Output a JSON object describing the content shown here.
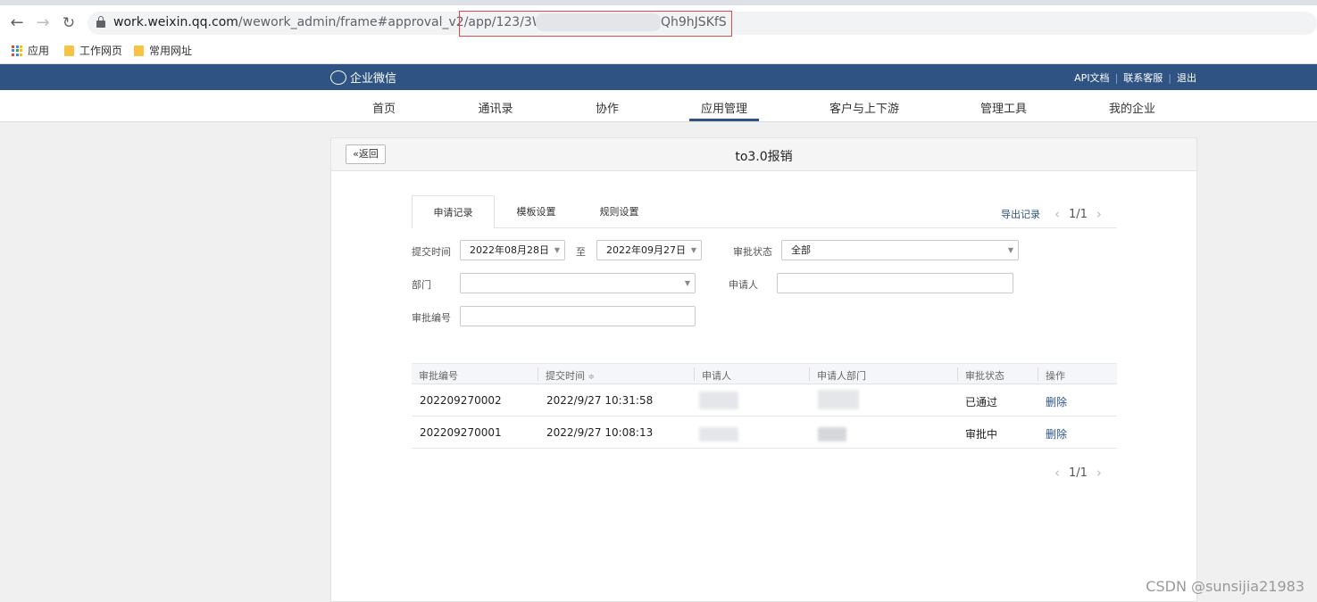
{
  "browser": {
    "url_host": "work.weixin.qq.com",
    "url_path": "/wework_admin/frame#approval_v2/app/123/3WKi3uFpijc",
    "url_tail": "Qh9hJSKfS",
    "bookmarks": [
      "应用",
      "工作网页",
      "常用网址"
    ]
  },
  "header": {
    "logo_text": "企业微信",
    "links": [
      "API文档",
      "联系客服",
      "退出"
    ]
  },
  "nav": {
    "items": [
      "首页",
      "通讯录",
      "协作",
      "应用管理",
      "客户与上下游",
      "管理工具",
      "我的企业"
    ],
    "active": "应用管理"
  },
  "card": {
    "back_label": "返回",
    "title": "to3.0报销"
  },
  "tabs": {
    "items": [
      "申请记录",
      "模板设置",
      "规则设置"
    ],
    "active": "申请记录",
    "export_label": "导出记录",
    "page_indicator": "1/1"
  },
  "filters": {
    "submit_time_label": "提交时间",
    "date_from": "2022年08月28日",
    "to_label": "至",
    "date_to": "2022年09月27日",
    "status_label": "审批状态",
    "status_value": "全部",
    "dept_label": "部门",
    "dept_value": "",
    "applicant_label": "申请人",
    "applicant_value": "",
    "approval_no_label": "审批编号",
    "approval_no_value": ""
  },
  "table": {
    "columns": [
      "审批编号",
      "提交时间",
      "申请人",
      "申请人部门",
      "审批状态",
      "操作"
    ],
    "sort_indicator": "≑",
    "rows": [
      {
        "id": "202209270002",
        "time": "2022/9/27 10:31:58",
        "status": "已通过",
        "action": "删除"
      },
      {
        "id": "202209270001",
        "time": "2022/9/27 10:08:13",
        "status": "审批中",
        "action": "删除"
      }
    ],
    "page_indicator": "1/1"
  },
  "watermark": "CSDN @sunsijia21983"
}
